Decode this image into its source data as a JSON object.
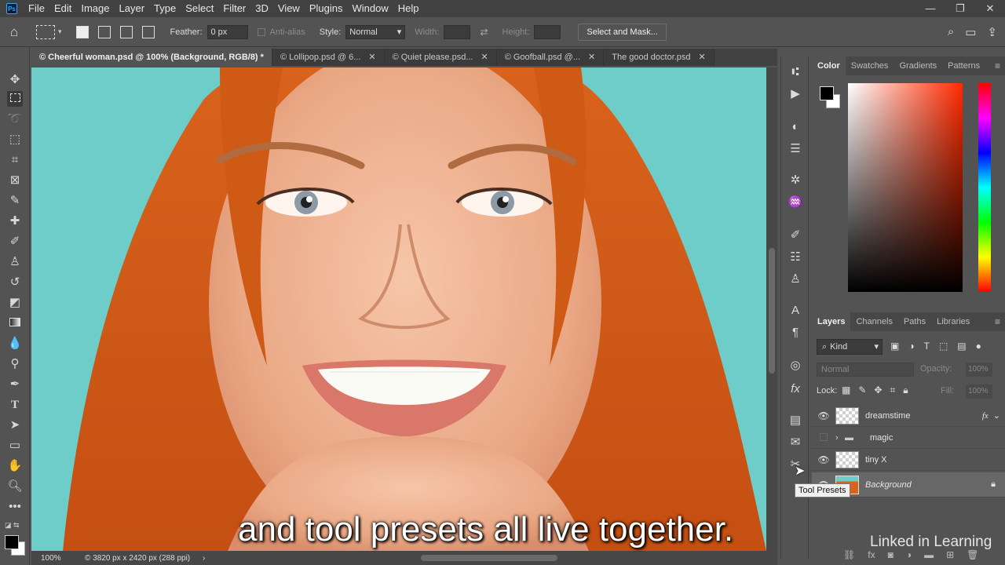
{
  "menubar": {
    "logo": "Ps",
    "items": [
      "File",
      "Edit",
      "Image",
      "Layer",
      "Type",
      "Select",
      "Filter",
      "3D",
      "View",
      "Plugins",
      "Window",
      "Help"
    ],
    "window_controls": [
      "—",
      "❐",
      "✕"
    ]
  },
  "options_bar": {
    "feather_label": "Feather:",
    "feather_value": "0 px",
    "antialias_label": "Anti-alias",
    "style_label": "Style:",
    "style_value": "Normal",
    "width_label": "Width:",
    "height_label": "Height:",
    "select_mask_label": "Select and Mask..."
  },
  "tabs": [
    {
      "label": "© Cheerful woman.psd @ 100% (Background, RGB/8) *",
      "active": true
    },
    {
      "label": "© Lollipop.psd @ 6...",
      "active": false
    },
    {
      "label": "© Quiet please.psd...",
      "active": false
    },
    {
      "label": "© Goofball.psd @...",
      "active": false
    },
    {
      "label": "The good doctor.psd",
      "active": false
    }
  ],
  "tab_close": "✕",
  "status": {
    "zoom": "100%",
    "doc_info": "© 3820 px x 2420 px (288 ppi)",
    "arrow": "›"
  },
  "color_panel": {
    "tabs": [
      "Color",
      "Swatches",
      "Gradients",
      "Patterns"
    ],
    "foreground": "#000000",
    "background": "#ffffff",
    "hue": "#ff2a00"
  },
  "layers_panel": {
    "tabs": [
      "Layers",
      "Channels",
      "Paths",
      "Libraries"
    ],
    "filter_kind": "Kind",
    "blend_mode": "Normal",
    "opacity_label": "Opacity:",
    "opacity_value": "100%",
    "lock_label": "Lock:",
    "fill_label": "Fill:",
    "fill_value": "100%",
    "layers": [
      {
        "name": "dreamstime",
        "visible": true,
        "fx": "fx"
      },
      {
        "name": "magic",
        "visible": false,
        "group": true
      },
      {
        "name": "tiny X",
        "visible": true
      },
      {
        "name": "Background",
        "visible": true,
        "locked": true
      }
    ]
  },
  "tooltip": "Tool Presets",
  "caption": "and tool presets all live together.",
  "watermark": "Linked in Learning"
}
